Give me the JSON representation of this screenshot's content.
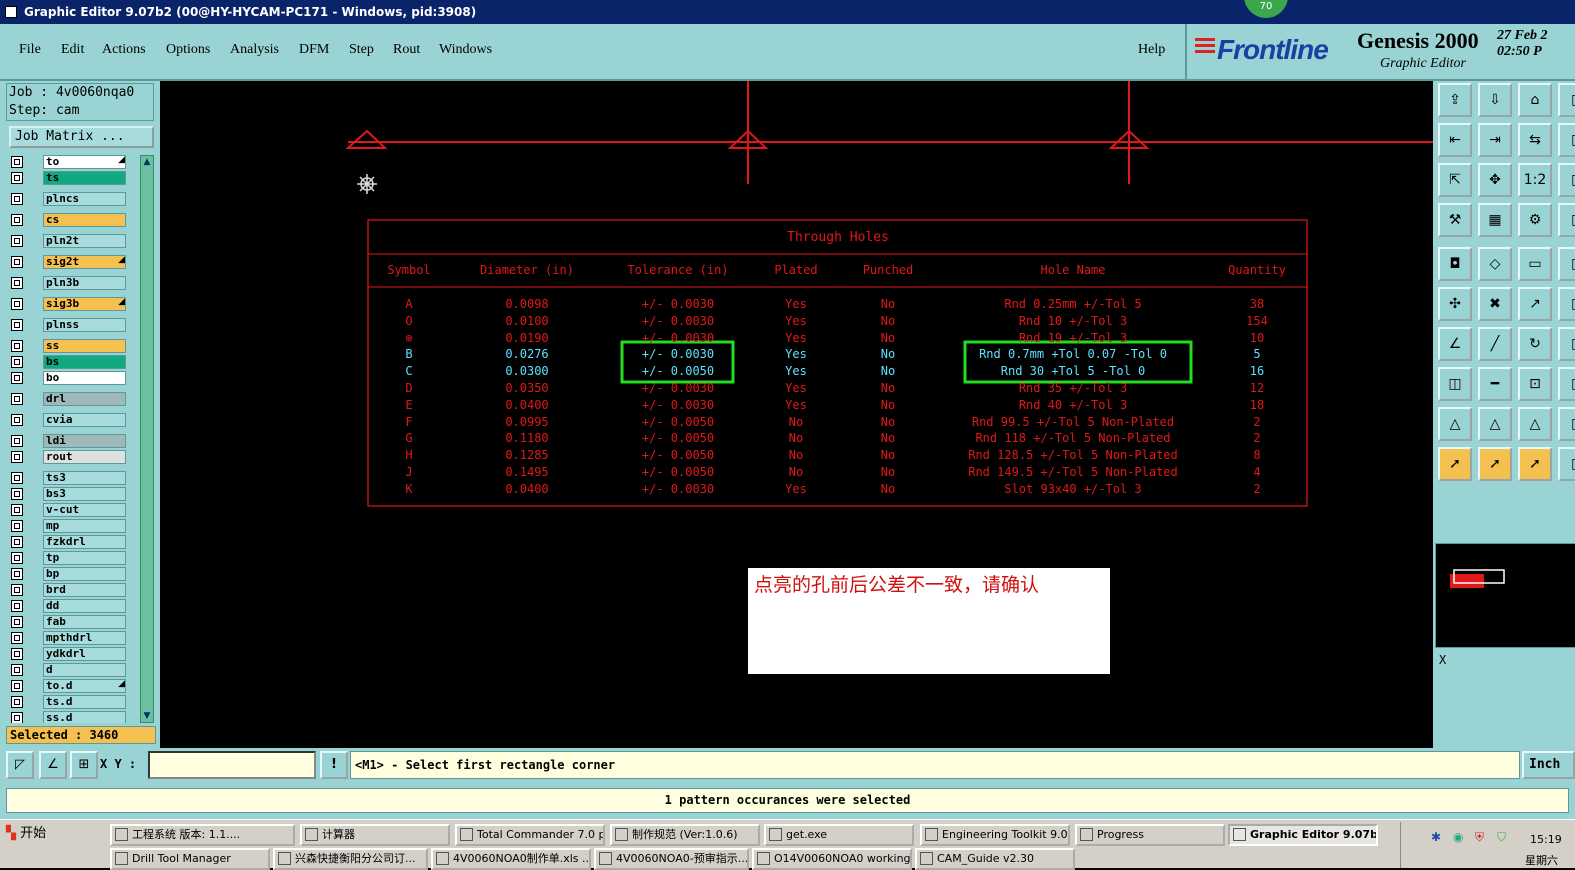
{
  "window": {
    "title": "Graphic Editor 9.07b2 (00@HY-HYCAM-PC171 - Windows, pid:3908)",
    "badge": "70"
  },
  "menu": {
    "items": [
      "File",
      "Edit",
      "Actions",
      "Options",
      "Analysis",
      "DFM",
      "Step",
      "Rout",
      "Windows"
    ],
    "help": "Help"
  },
  "brand": {
    "logo": "Frontline",
    "product": "Genesis 2000",
    "subtitle": "Graphic Editor",
    "date_line1": "27 Feb 2",
    "date_line2": "02:50 P"
  },
  "job": {
    "job_line": "Job : 4v0060nqa0",
    "step_line": "Step: cam",
    "matrix_button": "Job Matrix ..."
  },
  "layers": [
    {
      "name": "to",
      "color": "#ffffff",
      "mark": "◢"
    },
    {
      "name": "ts",
      "color": "#12a880",
      "mark": ""
    },
    {
      "name": "plncs",
      "color": "#a8dcdc",
      "mark": ""
    },
    {
      "name": "cs",
      "color": "#f4c050",
      "mark": ""
    },
    {
      "name": "pln2t",
      "color": "#a8dcdc",
      "mark": ""
    },
    {
      "name": "sig2t",
      "color": "#f4c050",
      "mark": "◢"
    },
    {
      "name": "pln3b",
      "color": "#a8dcdc",
      "mark": ""
    },
    {
      "name": "sig3b",
      "color": "#f4c050",
      "mark": "◢"
    },
    {
      "name": "plnss",
      "color": "#a8dcdc",
      "mark": ""
    },
    {
      "name": "ss",
      "color": "#f4c050",
      "mark": ""
    },
    {
      "name": "bs",
      "color": "#12a880",
      "mark": ""
    },
    {
      "name": "bo",
      "color": "#ffffff",
      "mark": ""
    },
    {
      "name": "drl",
      "color": "#a0b8b8",
      "mark": ""
    },
    {
      "name": "cvia",
      "color": "#a8dcdc",
      "mark": ""
    },
    {
      "name": "ldi",
      "color": "#a0b8b8",
      "mark": ""
    },
    {
      "name": "rout",
      "color": "#e0e0e0",
      "mark": ""
    },
    {
      "name": "ts3",
      "color": "#a8dcdc",
      "mark": ""
    },
    {
      "name": "bs3",
      "color": "#a8dcdc",
      "mark": ""
    },
    {
      "name": "v-cut",
      "color": "#a8dcdc",
      "mark": ""
    },
    {
      "name": "mp",
      "color": "#a8dcdc",
      "mark": ""
    },
    {
      "name": "fzkdrl",
      "color": "#a8dcdc",
      "mark": ""
    },
    {
      "name": "tp",
      "color": "#a8dcdc",
      "mark": ""
    },
    {
      "name": "bp",
      "color": "#a8dcdc",
      "mark": ""
    },
    {
      "name": "brd",
      "color": "#a8dcdc",
      "mark": ""
    },
    {
      "name": "dd",
      "color": "#a8dcdc",
      "mark": ""
    },
    {
      "name": "fab",
      "color": "#a8dcdc",
      "mark": ""
    },
    {
      "name": "mpthdrl",
      "color": "#a8dcdc",
      "mark": ""
    },
    {
      "name": "ydkdrl",
      "color": "#a8dcdc",
      "mark": ""
    },
    {
      "name": "d",
      "color": "#a8dcdc",
      "mark": ""
    },
    {
      "name": "to.d",
      "color": "#a8dcdc",
      "mark": "◢"
    },
    {
      "name": "ts.d",
      "color": "#a8dcdc",
      "mark": ""
    },
    {
      "name": "ss.d",
      "color": "#a8dcdc",
      "mark": ""
    }
  ],
  "selected_count": "Selected : 3460",
  "holes_table": {
    "title": "Through Holes",
    "headers": [
      "Symbol",
      "Diameter (in)",
      "Tolerance (in)",
      "Plated",
      "Punched",
      "Hole Name",
      "Quantity"
    ],
    "rows": [
      [
        "A",
        "0.0098",
        "+/- 0.0030",
        "Yes",
        "No",
        "Rnd 0.25mm +/-Tol 5",
        "38"
      ],
      [
        "O",
        "0.0100",
        "+/- 0.0030",
        "Yes",
        "No",
        "Rnd 10 +/-Tol 3",
        "154"
      ],
      [
        "⊕",
        "0.0190",
        "+/- 0.0030",
        "Yes",
        "No",
        "Rnd 19 +/-Tol 3",
        "10"
      ],
      [
        "B",
        "0.0276",
        "+/- 0.0030",
        "Yes",
        "No",
        "Rnd 0.7mm +Tol 0.07 -Tol 0",
        "5"
      ],
      [
        "C",
        "0.0300",
        "+/- 0.0050",
        "Yes",
        "No",
        "Rnd 30 +Tol 5 -Tol 0",
        "16"
      ],
      [
        "D",
        "0.0350",
        "+/- 0.0030",
        "Yes",
        "No",
        "Rnd 35 +/-Tol 3",
        "12"
      ],
      [
        "E",
        "0.0400",
        "+/- 0.0030",
        "Yes",
        "No",
        "Rnd 40 +/-Tol 3",
        "18"
      ],
      [
        "F",
        "0.0995",
        "+/- 0.0050",
        "No",
        "No",
        "Rnd 99.5 +/-Tol 5 Non-Plated",
        "2"
      ],
      [
        "G",
        "0.1180",
        "+/- 0.0050",
        "No",
        "No",
        "Rnd 118 +/-Tol 5 Non-Plated",
        "2"
      ],
      [
        "H",
        "0.1285",
        "+/- 0.0050",
        "No",
        "No",
        "Rnd 128.5 +/-Tol 5 Non-Plated",
        "8"
      ],
      [
        "J",
        "0.1495",
        "+/- 0.0050",
        "No",
        "No",
        "Rnd 149.5 +/-Tol 5 Non-Plated",
        "4"
      ],
      [
        "K",
        "0.0400",
        "+/- 0.0030",
        "Yes",
        "No",
        "Slot 93x40 +/-Tol 3",
        "2"
      ]
    ],
    "highlight_color": "#5fe0ff",
    "box_color": "#22dd22"
  },
  "annotation": "点亮的孔前后公差不一致，请确认",
  "right_panel": {
    "x_label": "X"
  },
  "bottom": {
    "xy_label": "X Y :",
    "xy_value": "",
    "info_button": "!",
    "prompt": "<M1> - Select first rectangle corner",
    "units": "Inch"
  },
  "status": "1 pattern occurances were selected",
  "taskbar": {
    "start": "开始",
    "row1": [
      "工程系统  版本: 1.1....",
      "计算器",
      "Total Commander 7.0 p...",
      "制作规范 (Ver:1.0.6)",
      "get.exe",
      "Engineering Toolkit 9.0...",
      "Progress",
      "Graphic Editor 9.07b..."
    ],
    "row2": [
      "Drill Tool Manager",
      "兴森快捷衡阳分公司订...",
      "4V0060NOA0制作单.xls ...",
      "4V0060NOA0-预审指示...",
      "O14V0060NOA0 working...",
      "CAM_Guide v2.30"
    ],
    "clock": "15:19",
    "day": "星期六"
  }
}
